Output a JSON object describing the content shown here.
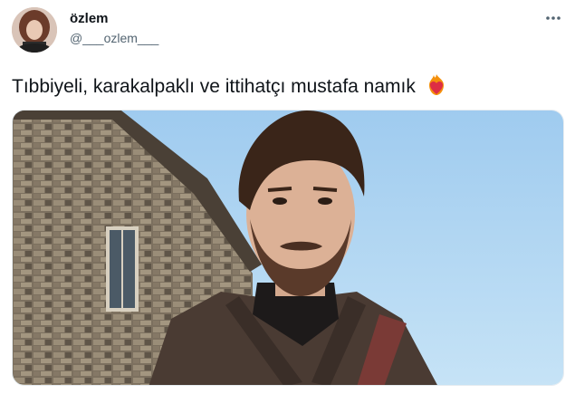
{
  "tweet": {
    "display_name": "özlem",
    "handle": "@___ozlem___",
    "text": "Tıbbiyeli, karakalpaklı ve ittihatçı mustafa namık",
    "emoji": "heart-on-fire-icon"
  },
  "colors": {
    "text": "#0f1419",
    "secondary": "#536471",
    "sky": "#a9d2f0"
  }
}
